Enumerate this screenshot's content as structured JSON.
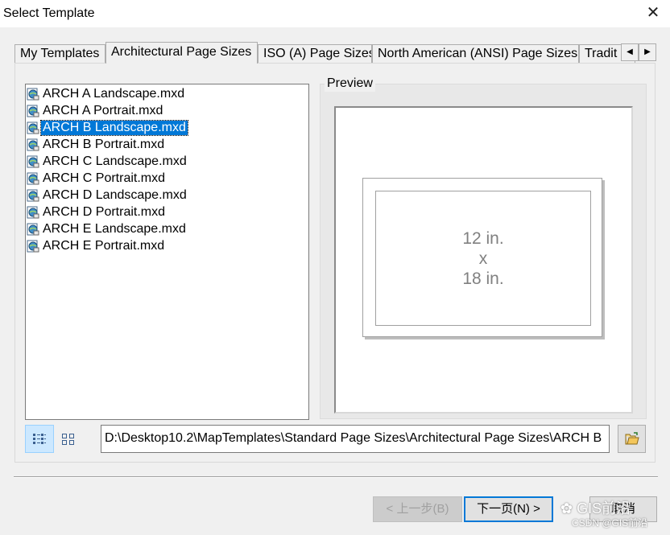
{
  "window": {
    "title": "Select Template",
    "close_glyph": "✕"
  },
  "tabs": [
    {
      "label": "My Templates",
      "active": false
    },
    {
      "label": "Architectural Page Sizes",
      "active": true
    },
    {
      "label": "ISO (A) Page Sizes",
      "active": false
    },
    {
      "label": "North American (ANSI) Page Sizes",
      "active": false
    },
    {
      "label": "Tradit",
      "active": false
    }
  ],
  "tab_scroll": {
    "left_glyph": "◀",
    "right_glyph": "▶"
  },
  "files": [
    {
      "name": "ARCH A Landscape.mxd",
      "selected": false
    },
    {
      "name": "ARCH A Portrait.mxd",
      "selected": false
    },
    {
      "name": "ARCH B Landscape.mxd",
      "selected": true
    },
    {
      "name": "ARCH B Portrait.mxd",
      "selected": false
    },
    {
      "name": "ARCH C Landscape.mxd",
      "selected": false
    },
    {
      "name": "ARCH C Portrait.mxd",
      "selected": false
    },
    {
      "name": "ARCH D Landscape.mxd",
      "selected": false
    },
    {
      "name": "ARCH D Portrait.mxd",
      "selected": false
    },
    {
      "name": "ARCH E Landscape.mxd",
      "selected": false
    },
    {
      "name": "ARCH E Portrait.mxd",
      "selected": false
    }
  ],
  "preview": {
    "legend": "Preview",
    "width_text": "12 in.",
    "times_text": "x",
    "height_text": "18 in."
  },
  "path": {
    "value": "D:\\Desktop10.2\\MapTemplates\\Standard Page Sizes\\Architectural Page Sizes\\ARCH B"
  },
  "view_modes": [
    {
      "icon": "list-view-icon",
      "active": true
    },
    {
      "icon": "thumbnail-view-icon",
      "active": false
    }
  ],
  "buttons": {
    "back_label": "< 上一步(B)",
    "next_label": "下一页(N) >",
    "cancel_label": "取消"
  },
  "watermark": {
    "badge_text": "GIS前沿",
    "csdn_text": "CSDN @GIS前沿"
  },
  "colors": {
    "selection": "#0078d7",
    "window_bg": "#f0f0f0",
    "default_button_border": "#0078d7"
  }
}
